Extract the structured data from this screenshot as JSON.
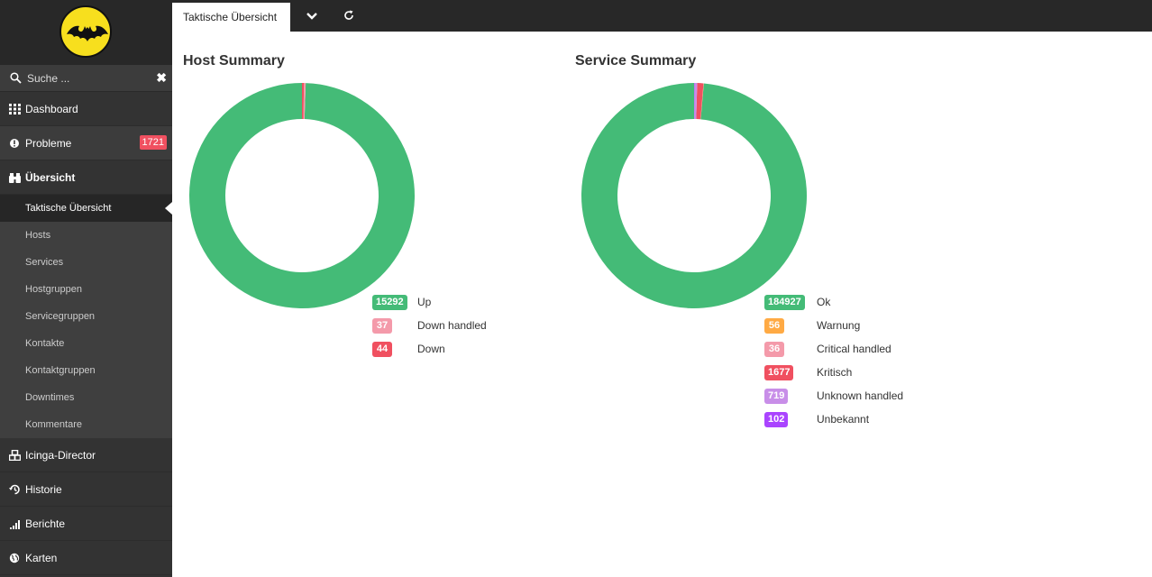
{
  "colors": {
    "ok": "#44bb77",
    "warning": "#ffaa44",
    "critical_handled": "#f49aaa",
    "critical": "#f05060",
    "unknown_handled": "#c88ee8",
    "unknown": "#aa44ff"
  },
  "sidebar": {
    "search": {
      "placeholder": "Suche ..."
    },
    "items": [
      {
        "label": "Dashboard",
        "icon": "dashboard-icon"
      },
      {
        "label": "Probleme",
        "icon": "alert-icon",
        "badge": "1721"
      },
      {
        "label": "Übersicht",
        "icon": "binoculars-icon"
      },
      {
        "label": "Icinga-Director",
        "icon": "cubes-icon"
      },
      {
        "label": "Historie",
        "icon": "history-icon"
      },
      {
        "label": "Berichte",
        "icon": "chart-bars-icon"
      },
      {
        "label": "Karten",
        "icon": "globe-icon"
      }
    ],
    "subitems": [
      "Taktische Übersicht",
      "Hosts",
      "Services",
      "Hostgruppen",
      "Servicegruppen",
      "Kontakte",
      "Kontaktgruppen",
      "Downtimes",
      "Kommentare"
    ]
  },
  "tabs": {
    "active": "Taktische Übersicht",
    "icons": [
      "chevron-down-icon",
      "refresh-icon"
    ]
  },
  "host_summary": {
    "title": "Host Summary",
    "states": [
      {
        "count": "15292",
        "label": "Up",
        "color": "#44bb77",
        "value": 15292
      },
      {
        "count": "37",
        "label": "Down handled",
        "color": "#f49aaa",
        "value": 37
      },
      {
        "count": "44",
        "label": "Down",
        "color": "#f05060",
        "value": 44
      }
    ]
  },
  "service_summary": {
    "title": "Service Summary",
    "states": [
      {
        "count": "184927",
        "label": "Ok",
        "color": "#44bb77",
        "value": 184927
      },
      {
        "count": "56",
        "label": "Warnung",
        "color": "#ffaa44",
        "value": 56
      },
      {
        "count": "36",
        "label": "Critical handled",
        "color": "#f49aaa",
        "value": 36
      },
      {
        "count": "1677",
        "label": "Kritisch",
        "color": "#f05060",
        "value": 1677
      },
      {
        "count": "719",
        "label": "Unknown handled",
        "color": "#c88ee8",
        "value": 719
      },
      {
        "count": "102",
        "label": "Unbekannt",
        "color": "#aa44ff",
        "value": 102
      }
    ]
  },
  "chart_data": [
    {
      "type": "pie",
      "title": "Host Summary",
      "categories": [
        "Up",
        "Down handled",
        "Down"
      ],
      "values": [
        15292,
        37,
        44
      ]
    },
    {
      "type": "pie",
      "title": "Service Summary",
      "categories": [
        "Ok",
        "Warnung",
        "Critical handled",
        "Kritisch",
        "Unknown handled",
        "Unbekannt"
      ],
      "values": [
        184927,
        56,
        36,
        1677,
        719,
        102
      ]
    }
  ]
}
